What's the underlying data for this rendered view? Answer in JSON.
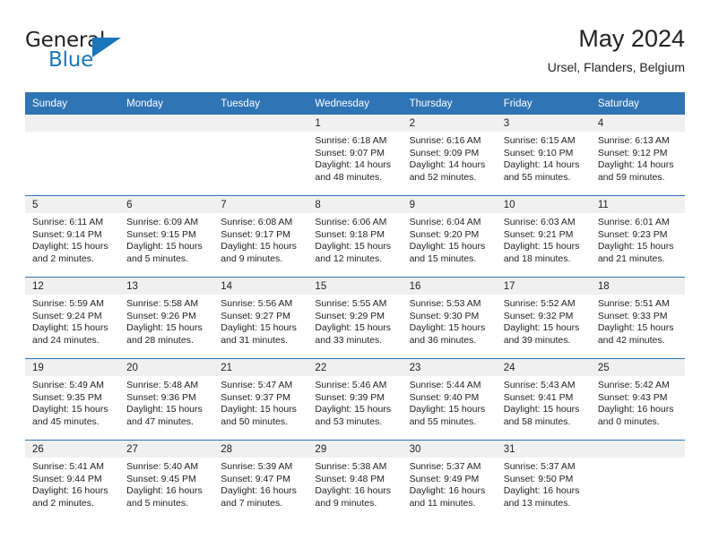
{
  "logo": {
    "word_top": "General",
    "word_bottom": "Blue",
    "triangle_color": "#1b75bb",
    "icon": "general-blue-logo"
  },
  "header": {
    "title": "May 2024",
    "location": "Ursel, Flanders, Belgium"
  },
  "theme": {
    "header_blue": "#2f74b5",
    "daynum_gray": "#f0f0f0",
    "text": "#222222"
  },
  "weekdays": [
    "Sunday",
    "Monday",
    "Tuesday",
    "Wednesday",
    "Thursday",
    "Friday",
    "Saturday"
  ],
  "weeks": [
    [
      {
        "day": "",
        "empty": true
      },
      {
        "day": "",
        "empty": true
      },
      {
        "day": "",
        "empty": true
      },
      {
        "day": "1",
        "sunrise": "Sunrise: 6:18 AM",
        "sunset": "Sunset: 9:07 PM",
        "daylight": "Daylight: 14 hours and 48 minutes."
      },
      {
        "day": "2",
        "sunrise": "Sunrise: 6:16 AM",
        "sunset": "Sunset: 9:09 PM",
        "daylight": "Daylight: 14 hours and 52 minutes."
      },
      {
        "day": "3",
        "sunrise": "Sunrise: 6:15 AM",
        "sunset": "Sunset: 9:10 PM",
        "daylight": "Daylight: 14 hours and 55 minutes."
      },
      {
        "day": "4",
        "sunrise": "Sunrise: 6:13 AM",
        "sunset": "Sunset: 9:12 PM",
        "daylight": "Daylight: 14 hours and 59 minutes."
      }
    ],
    [
      {
        "day": "5",
        "sunrise": "Sunrise: 6:11 AM",
        "sunset": "Sunset: 9:14 PM",
        "daylight": "Daylight: 15 hours and 2 minutes."
      },
      {
        "day": "6",
        "sunrise": "Sunrise: 6:09 AM",
        "sunset": "Sunset: 9:15 PM",
        "daylight": "Daylight: 15 hours and 5 minutes."
      },
      {
        "day": "7",
        "sunrise": "Sunrise: 6:08 AM",
        "sunset": "Sunset: 9:17 PM",
        "daylight": "Daylight: 15 hours and 9 minutes."
      },
      {
        "day": "8",
        "sunrise": "Sunrise: 6:06 AM",
        "sunset": "Sunset: 9:18 PM",
        "daylight": "Daylight: 15 hours and 12 minutes."
      },
      {
        "day": "9",
        "sunrise": "Sunrise: 6:04 AM",
        "sunset": "Sunset: 9:20 PM",
        "daylight": "Daylight: 15 hours and 15 minutes."
      },
      {
        "day": "10",
        "sunrise": "Sunrise: 6:03 AM",
        "sunset": "Sunset: 9:21 PM",
        "daylight": "Daylight: 15 hours and 18 minutes."
      },
      {
        "day": "11",
        "sunrise": "Sunrise: 6:01 AM",
        "sunset": "Sunset: 9:23 PM",
        "daylight": "Daylight: 15 hours and 21 minutes."
      }
    ],
    [
      {
        "day": "12",
        "sunrise": "Sunrise: 5:59 AM",
        "sunset": "Sunset: 9:24 PM",
        "daylight": "Daylight: 15 hours and 24 minutes."
      },
      {
        "day": "13",
        "sunrise": "Sunrise: 5:58 AM",
        "sunset": "Sunset: 9:26 PM",
        "daylight": "Daylight: 15 hours and 28 minutes."
      },
      {
        "day": "14",
        "sunrise": "Sunrise: 5:56 AM",
        "sunset": "Sunset: 9:27 PM",
        "daylight": "Daylight: 15 hours and 31 minutes."
      },
      {
        "day": "15",
        "sunrise": "Sunrise: 5:55 AM",
        "sunset": "Sunset: 9:29 PM",
        "daylight": "Daylight: 15 hours and 33 minutes."
      },
      {
        "day": "16",
        "sunrise": "Sunrise: 5:53 AM",
        "sunset": "Sunset: 9:30 PM",
        "daylight": "Daylight: 15 hours and 36 minutes."
      },
      {
        "day": "17",
        "sunrise": "Sunrise: 5:52 AM",
        "sunset": "Sunset: 9:32 PM",
        "daylight": "Daylight: 15 hours and 39 minutes."
      },
      {
        "day": "18",
        "sunrise": "Sunrise: 5:51 AM",
        "sunset": "Sunset: 9:33 PM",
        "daylight": "Daylight: 15 hours and 42 minutes."
      }
    ],
    [
      {
        "day": "19",
        "sunrise": "Sunrise: 5:49 AM",
        "sunset": "Sunset: 9:35 PM",
        "daylight": "Daylight: 15 hours and 45 minutes."
      },
      {
        "day": "20",
        "sunrise": "Sunrise: 5:48 AM",
        "sunset": "Sunset: 9:36 PM",
        "daylight": "Daylight: 15 hours and 47 minutes."
      },
      {
        "day": "21",
        "sunrise": "Sunrise: 5:47 AM",
        "sunset": "Sunset: 9:37 PM",
        "daylight": "Daylight: 15 hours and 50 minutes."
      },
      {
        "day": "22",
        "sunrise": "Sunrise: 5:46 AM",
        "sunset": "Sunset: 9:39 PM",
        "daylight": "Daylight: 15 hours and 53 minutes."
      },
      {
        "day": "23",
        "sunrise": "Sunrise: 5:44 AM",
        "sunset": "Sunset: 9:40 PM",
        "daylight": "Daylight: 15 hours and 55 minutes."
      },
      {
        "day": "24",
        "sunrise": "Sunrise: 5:43 AM",
        "sunset": "Sunset: 9:41 PM",
        "daylight": "Daylight: 15 hours and 58 minutes."
      },
      {
        "day": "25",
        "sunrise": "Sunrise: 5:42 AM",
        "sunset": "Sunset: 9:43 PM",
        "daylight": "Daylight: 16 hours and 0 minutes."
      }
    ],
    [
      {
        "day": "26",
        "sunrise": "Sunrise: 5:41 AM",
        "sunset": "Sunset: 9:44 PM",
        "daylight": "Daylight: 16 hours and 2 minutes."
      },
      {
        "day": "27",
        "sunrise": "Sunrise: 5:40 AM",
        "sunset": "Sunset: 9:45 PM",
        "daylight": "Daylight: 16 hours and 5 minutes."
      },
      {
        "day": "28",
        "sunrise": "Sunrise: 5:39 AM",
        "sunset": "Sunset: 9:47 PM",
        "daylight": "Daylight: 16 hours and 7 minutes."
      },
      {
        "day": "29",
        "sunrise": "Sunrise: 5:38 AM",
        "sunset": "Sunset: 9:48 PM",
        "daylight": "Daylight: 16 hours and 9 minutes."
      },
      {
        "day": "30",
        "sunrise": "Sunrise: 5:37 AM",
        "sunset": "Sunset: 9:49 PM",
        "daylight": "Daylight: 16 hours and 11 minutes."
      },
      {
        "day": "31",
        "sunrise": "Sunrise: 5:37 AM",
        "sunset": "Sunset: 9:50 PM",
        "daylight": "Daylight: 16 hours and 13 minutes."
      },
      {
        "day": "",
        "empty": true
      }
    ]
  ]
}
